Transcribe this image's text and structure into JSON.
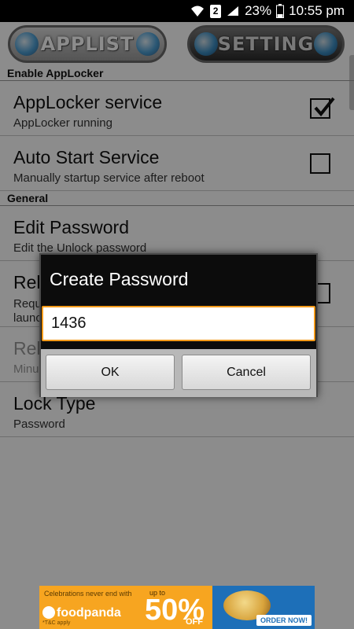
{
  "status_bar": {
    "sim": "2",
    "battery": "23%",
    "time": "10:55 pm"
  },
  "tabs": {
    "applist": "APPLIST",
    "setting": "SETTING"
  },
  "sections": [
    {
      "header": "Enable AppLocker",
      "items": [
        {
          "title": "AppLocker service",
          "summary": "AppLocker running",
          "checked": true
        },
        {
          "title": "Auto Start Service",
          "summary": "Manually startup service after reboot",
          "checked": false
        }
      ]
    },
    {
      "header": "General",
      "items": [
        {
          "title": "Edit Password",
          "summary": "Edit the Unlock password"
        },
        {
          "title": "Rel",
          "summary_line1": "Requ",
          "summary_line2": "launc",
          "checked": false
        },
        {
          "title": "Rel",
          "summary": "Minu",
          "disabled": true
        },
        {
          "title": "Lock Type",
          "summary": "Password"
        }
      ]
    }
  ],
  "dialog": {
    "title": "Create Password",
    "input_value": "1436",
    "ok_label": "OK",
    "cancel_label": "Cancel"
  },
  "ad": {
    "tagline_line1": "Celebrations never end with",
    "brand": "foodpanda",
    "note": "*T&C apply",
    "upto": "up to",
    "percent": "50%",
    "off": "OFF",
    "cta": "ORDER NOW!"
  },
  "colors": {
    "accent_orange": "#f39a1a",
    "ad_orange": "#f3a21c",
    "ad_blue": "#1d6fb8"
  }
}
